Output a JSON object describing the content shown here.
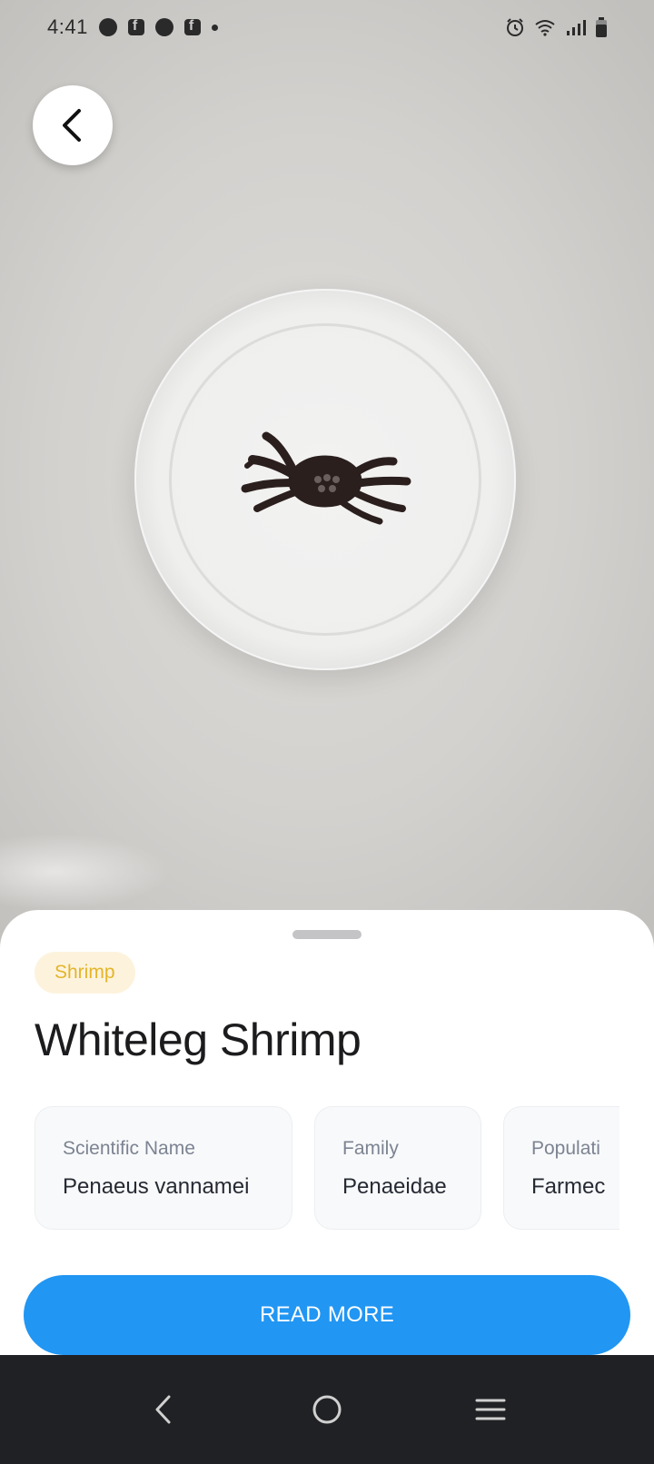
{
  "status_bar": {
    "time": "4:41",
    "left_icons": [
      "messenger-icon",
      "facebook-icon",
      "chat-icon",
      "facebook-icon",
      "dot-icon"
    ],
    "right_icons": [
      "alarm-icon",
      "wifi-icon",
      "signal-icon",
      "battery-icon"
    ]
  },
  "header": {
    "back_icon": "back-arrow-icon"
  },
  "sheet": {
    "category_tag": "Shrimp",
    "title": "Whiteleg Shrimp",
    "info_cards": [
      {
        "label": "Scientific Name",
        "value": "Penaeus vannamei"
      },
      {
        "label": "Family",
        "value": "Penaeidae"
      },
      {
        "label": "Populati",
        "value": "Farmec"
      }
    ],
    "read_more_label": "READ MORE"
  },
  "nav": {
    "icons": [
      "nav-back-icon",
      "nav-home-icon",
      "nav-recents-icon"
    ]
  },
  "colors": {
    "accent": "#2196f3",
    "tag_bg": "#fdf3dd",
    "tag_text": "#e3b52a",
    "nav_bg": "#202124"
  }
}
